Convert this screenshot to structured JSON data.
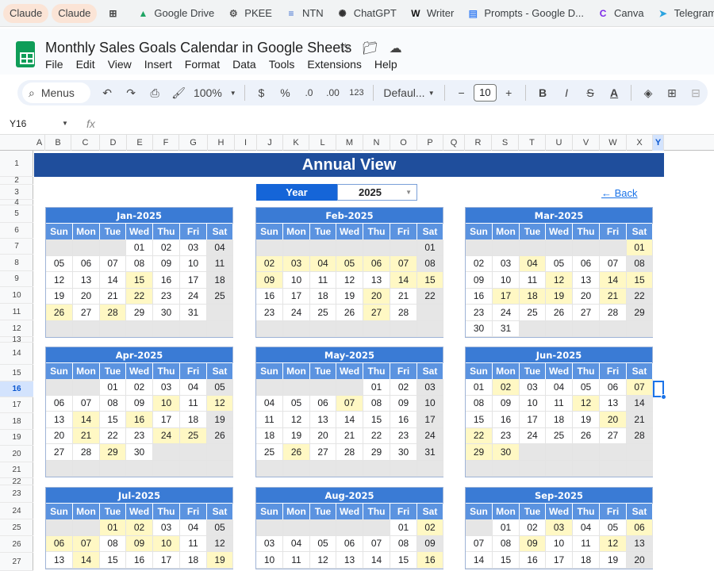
{
  "bookmarks": [
    {
      "label": "Claude",
      "icon": "claude-icon",
      "style": "pill"
    },
    {
      "label": "Claude",
      "icon": "claude-icon",
      "style": "pill"
    },
    {
      "label": "",
      "icon": "apps-grid-icon",
      "style": "plain"
    },
    {
      "label": "Google Drive",
      "icon": "google-drive-icon",
      "style": "plain"
    },
    {
      "label": "PKEE",
      "icon": "pkee-icon",
      "style": "plain"
    },
    {
      "label": "NTN",
      "icon": "ntn-icon",
      "style": "plain"
    },
    {
      "label": "ChatGPT",
      "icon": "chatgpt-icon",
      "style": "plain"
    },
    {
      "label": "Writer",
      "icon": "writer-icon",
      "style": "plain"
    },
    {
      "label": "Prompts - Google D...",
      "icon": "google-docs-icon",
      "style": "plain"
    },
    {
      "label": "Canva",
      "icon": "canva-icon",
      "style": "plain"
    },
    {
      "label": "Telegram",
      "icon": "telegram-icon",
      "style": "plain"
    }
  ],
  "doc": {
    "title": "Monthly Sales Goals Calendar in Google Sheets"
  },
  "menus": [
    "File",
    "Edit",
    "View",
    "Insert",
    "Format",
    "Data",
    "Tools",
    "Extensions",
    "Help"
  ],
  "toolbar": {
    "search_label": "Menus",
    "zoom": "100%",
    "currency": "$",
    "percent": "%",
    "dec_decrease": ".0",
    "dec_increase": ".00",
    "number_format": "123",
    "font": "Defaul...",
    "font_size": "10"
  },
  "formula_bar": {
    "name_box": "Y16",
    "fx": "fx"
  },
  "columns": [
    "A",
    "B",
    "C",
    "D",
    "E",
    "F",
    "G",
    "H",
    "I",
    "J",
    "K",
    "L",
    "M",
    "N",
    "O",
    "P",
    "Q",
    "R",
    "S",
    "T",
    "U",
    "V",
    "W",
    "X",
    "Y"
  ],
  "selected_column": "Y",
  "rows": [
    "1",
    "2",
    "3",
    "4",
    "5",
    "6",
    "7",
    "8",
    "9",
    "10",
    "11",
    "12",
    "13",
    "14",
    "15",
    "16",
    "17",
    "18",
    "19",
    "20",
    "21",
    "22",
    "23",
    "24",
    "25",
    "26",
    "27"
  ],
  "selected_row": "16",
  "sheet": {
    "banner": "Annual View",
    "year_label": "Year",
    "year_value": "2025",
    "back_link": "← Back",
    "weekdays": [
      "Sun",
      "Mon",
      "Tue",
      "Wed",
      "Thu",
      "Fri",
      "Sat"
    ]
  },
  "calendars": [
    {
      "title": "Jan-2025",
      "weeks": [
        [
          "",
          "",
          "",
          "01",
          "02",
          "03",
          "04"
        ],
        [
          "05",
          "06",
          "07",
          "08",
          "09",
          "10",
          "11"
        ],
        [
          "12",
          "13",
          "14",
          "15",
          "16",
          "17",
          "18"
        ],
        [
          "19",
          "20",
          "21",
          "22",
          "23",
          "24",
          "25"
        ],
        [
          "26",
          "27",
          "28",
          "29",
          "30",
          "31",
          ""
        ],
        [
          "",
          "",
          "",
          "",
          "",
          "",
          ""
        ]
      ],
      "highlighted": [
        "15",
        "22",
        "26",
        "28"
      ]
    },
    {
      "title": "Feb-2025",
      "weeks": [
        [
          "",
          "",
          "",
          "",
          "",
          "",
          "01"
        ],
        [
          "02",
          "03",
          "04",
          "05",
          "06",
          "07",
          "08"
        ],
        [
          "09",
          "10",
          "11",
          "12",
          "13",
          "14",
          "15"
        ],
        [
          "16",
          "17",
          "18",
          "19",
          "20",
          "21",
          "22"
        ],
        [
          "23",
          "24",
          "25",
          "26",
          "27",
          "28",
          ""
        ],
        [
          "",
          "",
          "",
          "",
          "",
          "",
          ""
        ]
      ],
      "highlighted": [
        "02",
        "03",
        "04",
        "05",
        "06",
        "07",
        "09",
        "14",
        "15",
        "20",
        "27"
      ]
    },
    {
      "title": "Mar-2025",
      "weeks": [
        [
          "",
          "",
          "",
          "",
          "",
          "",
          "01"
        ],
        [
          "02",
          "03",
          "04",
          "05",
          "06",
          "07",
          "08"
        ],
        [
          "09",
          "10",
          "11",
          "12",
          "13",
          "14",
          "15"
        ],
        [
          "16",
          "17",
          "18",
          "19",
          "20",
          "21",
          "22"
        ],
        [
          "23",
          "24",
          "25",
          "26",
          "27",
          "28",
          "29"
        ],
        [
          "30",
          "31",
          "",
          "",
          "",
          "",
          ""
        ]
      ],
      "highlighted": [
        "01",
        "04",
        "12",
        "14",
        "15",
        "17",
        "18",
        "19",
        "21"
      ]
    },
    {
      "title": "Apr-2025",
      "weeks": [
        [
          "",
          "",
          "01",
          "02",
          "03",
          "04",
          "05"
        ],
        [
          "06",
          "07",
          "08",
          "09",
          "10",
          "11",
          "12"
        ],
        [
          "13",
          "14",
          "15",
          "16",
          "17",
          "18",
          "19"
        ],
        [
          "20",
          "21",
          "22",
          "23",
          "24",
          "25",
          "26"
        ],
        [
          "27",
          "28",
          "29",
          "30",
          "",
          "",
          ""
        ],
        [
          "",
          "",
          "",
          "",
          "",
          "",
          ""
        ]
      ],
      "highlighted": [
        "10",
        "12",
        "14",
        "16",
        "21",
        "24",
        "25",
        "29"
      ]
    },
    {
      "title": "May-2025",
      "weeks": [
        [
          "",
          "",
          "",
          "",
          "01",
          "02",
          "03"
        ],
        [
          "04",
          "05",
          "06",
          "07",
          "08",
          "09",
          "10"
        ],
        [
          "11",
          "12",
          "13",
          "14",
          "15",
          "16",
          "17"
        ],
        [
          "18",
          "19",
          "20",
          "21",
          "22",
          "23",
          "24"
        ],
        [
          "25",
          "26",
          "27",
          "28",
          "29",
          "30",
          "31"
        ],
        [
          "",
          "",
          "",
          "",
          "",
          "",
          ""
        ]
      ],
      "highlighted": [
        "07",
        "26"
      ]
    },
    {
      "title": "Jun-2025",
      "weeks": [
        [
          "01",
          "02",
          "03",
          "04",
          "05",
          "06",
          "07"
        ],
        [
          "08",
          "09",
          "10",
          "11",
          "12",
          "13",
          "14"
        ],
        [
          "15",
          "16",
          "17",
          "18",
          "19",
          "20",
          "21"
        ],
        [
          "22",
          "23",
          "24",
          "25",
          "26",
          "27",
          "28"
        ],
        [
          "29",
          "30",
          "",
          "",
          "",
          "",
          ""
        ],
        [
          "",
          "",
          "",
          "",
          "",
          "",
          ""
        ]
      ],
      "highlighted": [
        "02",
        "07",
        "12",
        "20",
        "22",
        "29",
        "30"
      ]
    },
    {
      "title": "Jul-2025",
      "weeks": [
        [
          "",
          "",
          "01",
          "02",
          "03",
          "04",
          "05"
        ],
        [
          "06",
          "07",
          "08",
          "09",
          "10",
          "11",
          "12"
        ],
        [
          "13",
          "14",
          "15",
          "16",
          "17",
          "18",
          "19"
        ]
      ],
      "highlighted": [
        "01",
        "02",
        "06",
        "07",
        "09",
        "10",
        "14",
        "19"
      ]
    },
    {
      "title": "Aug-2025",
      "weeks": [
        [
          "",
          "",
          "",
          "",
          "",
          "01",
          "02"
        ],
        [
          "03",
          "04",
          "05",
          "06",
          "07",
          "08",
          "09"
        ],
        [
          "10",
          "11",
          "12",
          "13",
          "14",
          "15",
          "16"
        ]
      ],
      "highlighted": [
        "02",
        "16"
      ]
    },
    {
      "title": "Sep-2025",
      "weeks": [
        [
          "",
          "01",
          "02",
          "03",
          "04",
          "05",
          "06"
        ],
        [
          "07",
          "08",
          "09",
          "10",
          "11",
          "12",
          "13"
        ],
        [
          "14",
          "15",
          "16",
          "17",
          "18",
          "19",
          "20"
        ]
      ],
      "highlighted": [
        "03",
        "06",
        "09",
        "12"
      ]
    }
  ],
  "colors": {
    "banner": "#1f4e9c",
    "month_header": "#3a7bd5",
    "weekday_header": "#5b93e0",
    "highlight": "#fff8c4",
    "weekend": "#e6e6e6"
  }
}
